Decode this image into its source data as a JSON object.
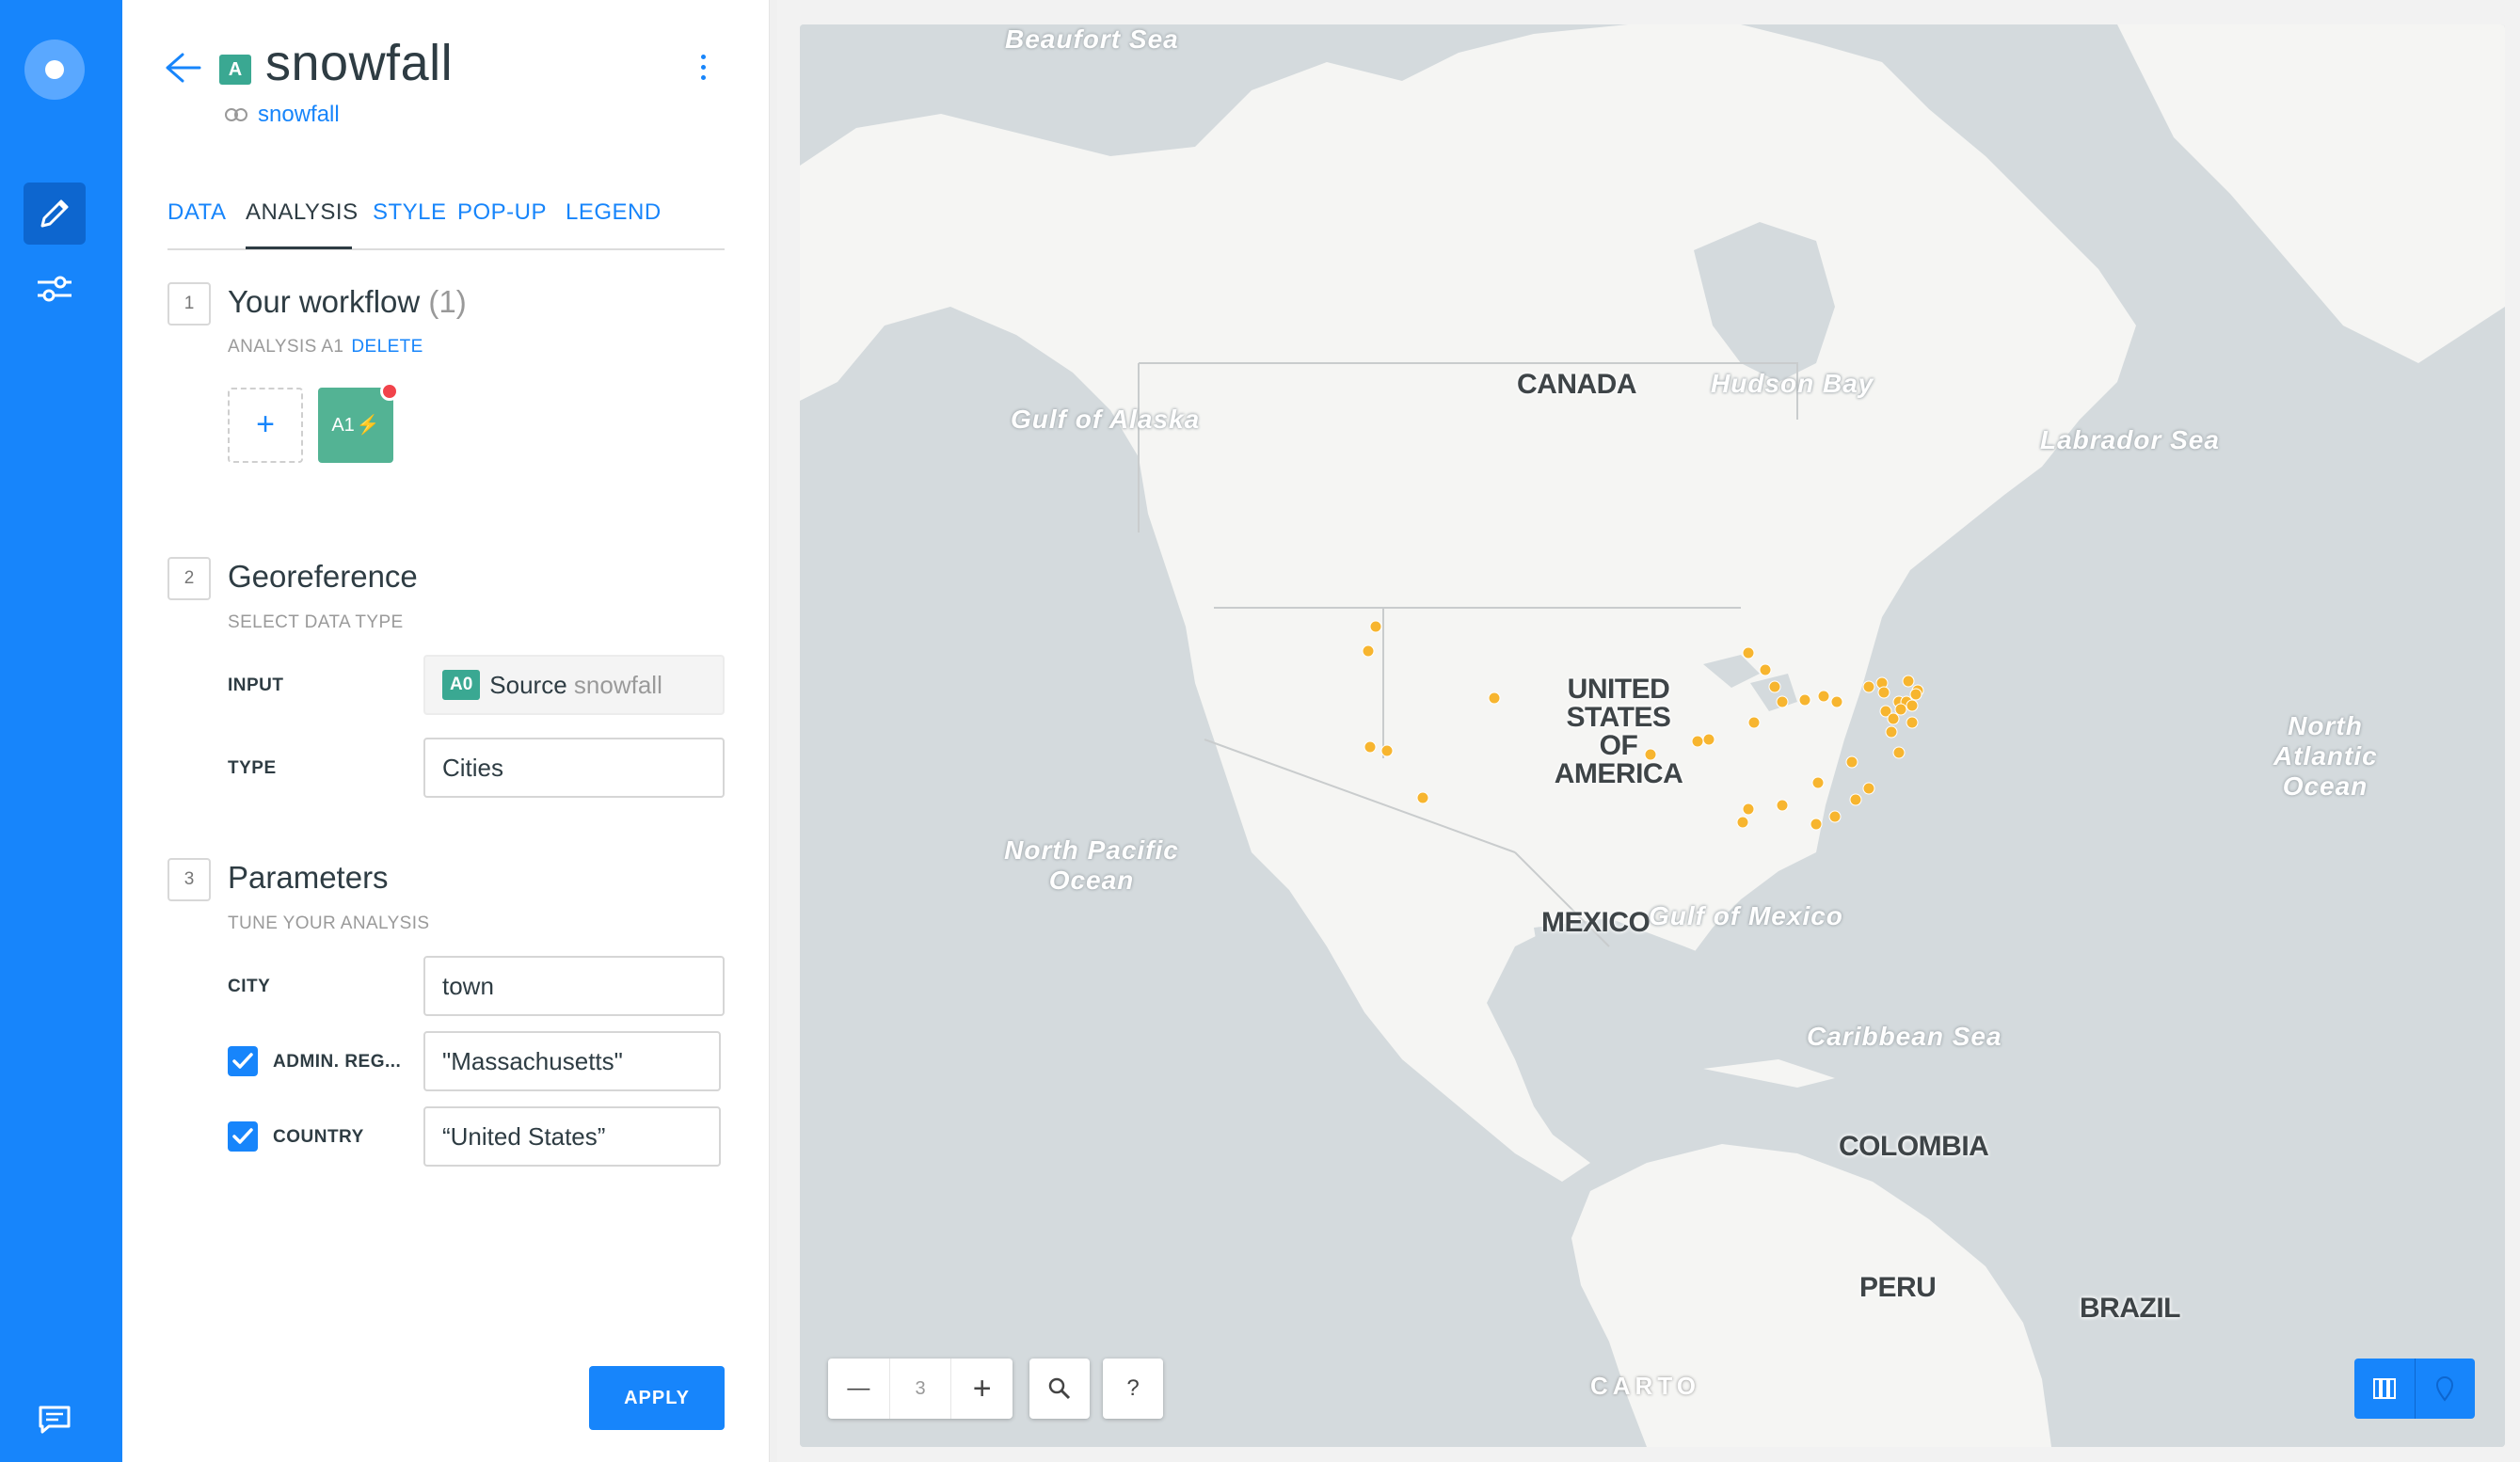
{
  "layer": {
    "letter": "A",
    "title": "snowfall",
    "source_name": "snowfall"
  },
  "tabs": [
    {
      "label": "DATA",
      "active": false
    },
    {
      "label": "ANALYSIS",
      "active": true
    },
    {
      "label": "STYLE",
      "active": false
    },
    {
      "label": "POP-UP",
      "active": false
    },
    {
      "label": "LEGEND",
      "active": false
    }
  ],
  "workflow": {
    "step": "1",
    "title": "Your workflow",
    "count": "(1)",
    "subtitle": "ANALYSIS A1",
    "delete_label": "DELETE",
    "add_label": "+",
    "node_label": "A1"
  },
  "georeference": {
    "step": "2",
    "title": "Georeference",
    "subtitle": "SELECT DATA TYPE",
    "input_label": "INPUT",
    "input_tag": "A0",
    "input_source_word": "Source",
    "input_source_name": "snowfall",
    "type_label": "TYPE",
    "type_value": "Cities"
  },
  "parameters": {
    "step": "3",
    "title": "Parameters",
    "subtitle": "TUNE YOUR ANALYSIS",
    "city_label": "CITY",
    "city_value": "town",
    "admin_label": "ADMIN. REG...",
    "admin_value": "\"Massachusetts\"",
    "admin_checked": true,
    "country_label": "COUNTRY",
    "country_value": "“United States”",
    "country_checked": true
  },
  "apply_label": "APPLY",
  "map": {
    "zoom": "3",
    "zoom_out": "—",
    "zoom_in": "+",
    "help": "?",
    "attribution": "CARTO",
    "labels": {
      "beaufort": "Beaufort Sea",
      "alaska": "Gulf of Alaska",
      "hudson": "Hudson Bay",
      "labrador": "Labrador Sea",
      "canada": "CANADA",
      "usa": "UNITED STATES OF AMERICA",
      "north_pacific": "North Pacific Ocean",
      "north_atlantic": "North Atlantic Ocean",
      "mexico": "MEXICO",
      "gulf_mexico": "Gulf of Mexico",
      "caribbean": "Caribbean Sea",
      "colombia": "COLOMBIA",
      "peru": "PERU",
      "brazil": "BRAZIL"
    },
    "point_color": "#f7b52f"
  },
  "colors": {
    "accent": "#1785fb",
    "layer_green": "#3aa892",
    "alert_red": "#f1434b"
  }
}
